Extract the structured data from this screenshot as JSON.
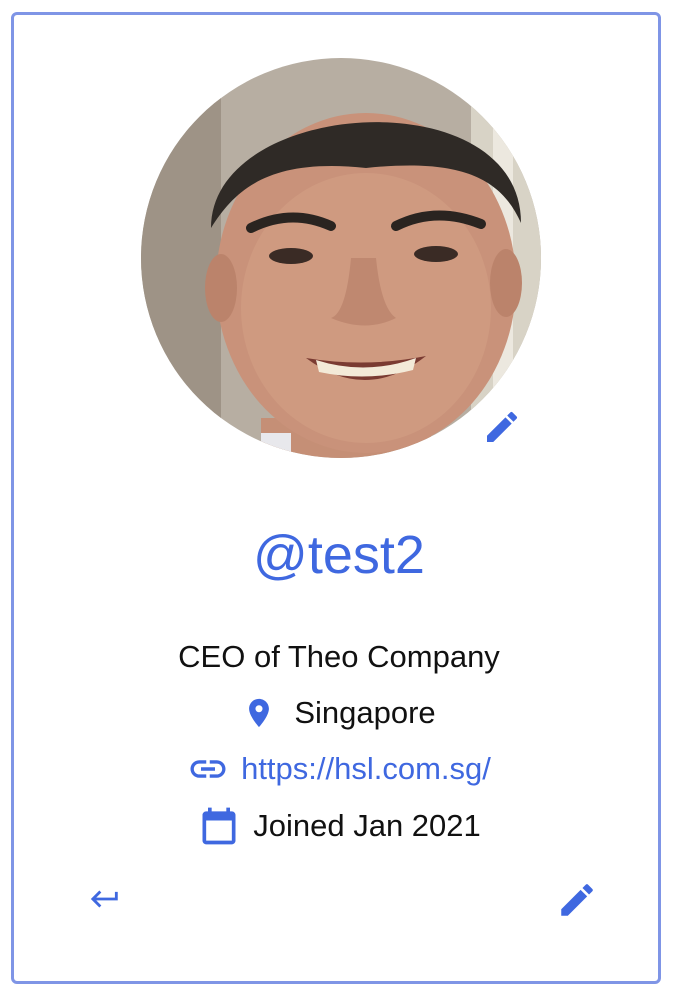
{
  "profile": {
    "username": "@test2",
    "bio": "CEO of Theo Company",
    "location": "Singapore",
    "website": "https://hsl.com.sg/",
    "joined": "Joined Jan 2021"
  },
  "icons": {
    "avatar_edit": "pencil-icon",
    "location": "map-pin-icon",
    "website": "link-icon",
    "joined": "calendar-icon",
    "back": "return-arrow-icon",
    "edit": "pencil-icon"
  },
  "colors": {
    "accent": "#3f68e0",
    "border": "#7f95e6",
    "text": "#111111"
  }
}
